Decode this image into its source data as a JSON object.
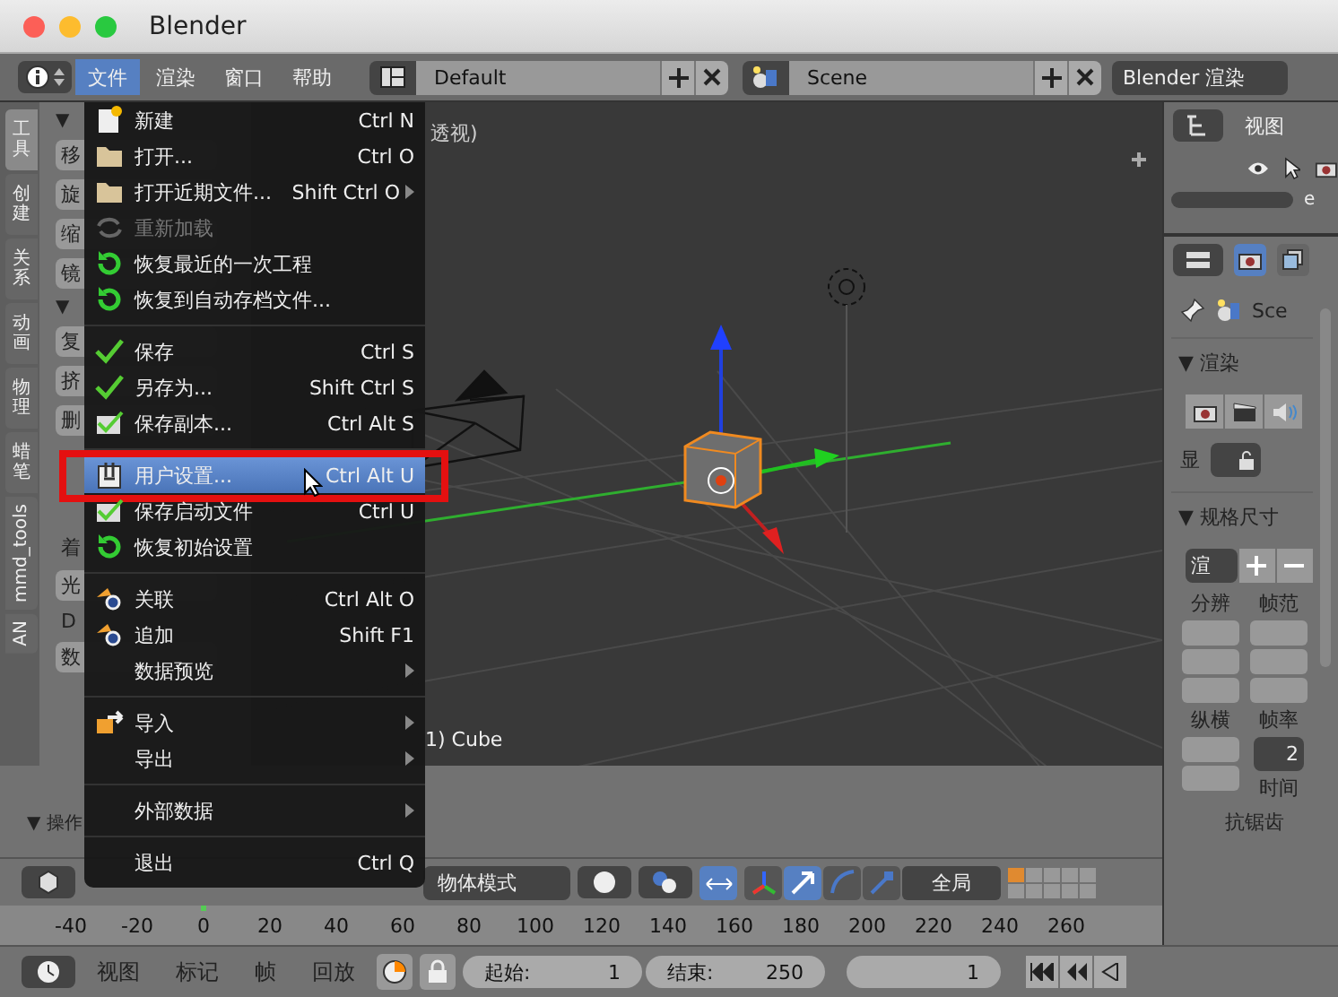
{
  "window": {
    "title": "Blender"
  },
  "header": {
    "menus": [
      {
        "label": "文件",
        "selected": true
      },
      {
        "label": "渲染",
        "selected": false
      },
      {
        "label": "窗口",
        "selected": false
      },
      {
        "label": "帮助",
        "selected": false
      }
    ],
    "layout": "Default",
    "scene": "Scene",
    "engine": "Blender 渲染"
  },
  "tool_tabs": [
    {
      "label": "工具",
      "selected": true
    },
    {
      "label": "创建",
      "selected": false
    },
    {
      "label": "关系",
      "selected": false
    },
    {
      "label": "动画",
      "selected": false
    },
    {
      "label": "物理",
      "selected": false
    },
    {
      "label": "蜡笔",
      "selected": false
    },
    {
      "label": "mmd_tools",
      "selected": false
    },
    {
      "label": "AN",
      "selected": false
    }
  ],
  "tool_panel": [
    {
      "kind": "section",
      "label": "▼"
    },
    {
      "kind": "button",
      "label": "移"
    },
    {
      "kind": "button",
      "label": "旋"
    },
    {
      "kind": "button",
      "label": "缩"
    },
    {
      "kind": "button",
      "label": "镜"
    },
    {
      "kind": "section",
      "label": "▼"
    },
    {
      "kind": "button",
      "label": "复"
    },
    {
      "kind": "button",
      "label": "挤"
    },
    {
      "kind": "button",
      "label": "删"
    },
    {
      "kind": "label",
      "label": "着"
    },
    {
      "kind": "button",
      "label": "光"
    },
    {
      "kind": "label",
      "label": "D"
    },
    {
      "kind": "button",
      "label": "数"
    }
  ],
  "operator_panel": {
    "label": "▼ 操作"
  },
  "file_menu": [
    {
      "kind": "item",
      "label": "新建",
      "shortcut": "Ctrl N",
      "submenu": false,
      "disabled": false,
      "selected": false,
      "annotated": false
    },
    {
      "kind": "item",
      "label": "打开...",
      "shortcut": "Ctrl O",
      "submenu": false,
      "disabled": false,
      "selected": false,
      "annotated": false
    },
    {
      "kind": "item",
      "label": "打开近期文件...",
      "shortcut": "Shift Ctrl O",
      "submenu": true,
      "disabled": false,
      "selected": false,
      "annotated": false
    },
    {
      "kind": "item",
      "label": "重新加载",
      "submenu": false,
      "disabled": true,
      "selected": false,
      "annotated": false
    },
    {
      "kind": "item",
      "label": "恢复最近的一次工程",
      "submenu": false,
      "disabled": false,
      "selected": false,
      "annotated": false
    },
    {
      "kind": "item",
      "label": "恢复到自动存档文件...",
      "submenu": false,
      "disabled": false,
      "selected": false,
      "annotated": false
    },
    {
      "kind": "separator"
    },
    {
      "kind": "item",
      "label": "保存",
      "shortcut": "Ctrl S",
      "submenu": false,
      "disabled": false,
      "selected": false,
      "annotated": false
    },
    {
      "kind": "item",
      "label": "另存为...",
      "shortcut": "Shift Ctrl S",
      "submenu": false,
      "disabled": false,
      "selected": false,
      "annotated": false
    },
    {
      "kind": "item",
      "label": "保存副本...",
      "shortcut": "Ctrl Alt S",
      "submenu": false,
      "disabled": false,
      "selected": false,
      "annotated": false
    },
    {
      "kind": "separator"
    },
    {
      "kind": "item",
      "label": "用户设置...",
      "shortcut": "Ctrl Alt U",
      "submenu": false,
      "disabled": false,
      "selected": true,
      "annotated": true
    },
    {
      "kind": "item",
      "label": "保存启动文件",
      "shortcut": "Ctrl U",
      "submenu": false,
      "disabled": false,
      "selected": false,
      "annotated": false
    },
    {
      "kind": "item",
      "label": "恢复初始设置",
      "submenu": false,
      "disabled": false,
      "selected": false,
      "annotated": false
    },
    {
      "kind": "separator"
    },
    {
      "kind": "item",
      "label": "关联",
      "shortcut": "Ctrl Alt O",
      "submenu": false,
      "disabled": false,
      "selected": false,
      "annotated": false
    },
    {
      "kind": "item",
      "label": "追加",
      "shortcut": "Shift F1",
      "submenu": false,
      "disabled": false,
      "selected": false,
      "annotated": false
    },
    {
      "kind": "item",
      "label": "数据预览",
      "submenu": true,
      "disabled": false,
      "selected": false,
      "annotated": false
    },
    {
      "kind": "separator"
    },
    {
      "kind": "item",
      "label": "导入",
      "submenu": true,
      "disabled": false,
      "selected": false,
      "annotated": false
    },
    {
      "kind": "item",
      "label": "导出",
      "submenu": true,
      "disabled": false,
      "selected": false,
      "annotated": false
    },
    {
      "kind": "separator"
    },
    {
      "kind": "item",
      "label": "外部数据",
      "submenu": true,
      "disabled": false,
      "selected": false,
      "annotated": false
    },
    {
      "kind": "separator"
    },
    {
      "kind": "item",
      "label": "退出",
      "shortcut": "Ctrl Q",
      "submenu": false,
      "disabled": false,
      "selected": false,
      "annotated": false
    }
  ],
  "viewport": {
    "view_label": "透视)",
    "object_label": "1) Cube"
  },
  "viewport_header": {
    "mode": "物体模式",
    "orientation": "全局"
  },
  "timeline": {
    "ruler": [
      "-40",
      "-20",
      "0",
      "20",
      "40",
      "60",
      "80",
      "100",
      "120",
      "140",
      "160",
      "180",
      "200",
      "220",
      "240",
      "260"
    ],
    "menus": [
      "视图",
      "标记",
      "帧",
      "回放"
    ],
    "start_label": "起始:",
    "start": "1",
    "end_label": "结束:",
    "end": "250",
    "current": "1"
  },
  "outliner": {
    "menu": "视图",
    "search": "e"
  },
  "properties": {
    "scene_label": "Sce",
    "render_section": "▼ 渲染",
    "display_label": "显",
    "dimensions_section": "▼ 规格尺寸",
    "preset": "渲",
    "resolution_label": "分辨",
    "frame_range_label": "帧范",
    "aspect_label": "纵横",
    "frame_rate_label": "帧率",
    "frame_rate": "2",
    "time_label": "时间",
    "antialias_label": "抗锯齿"
  }
}
